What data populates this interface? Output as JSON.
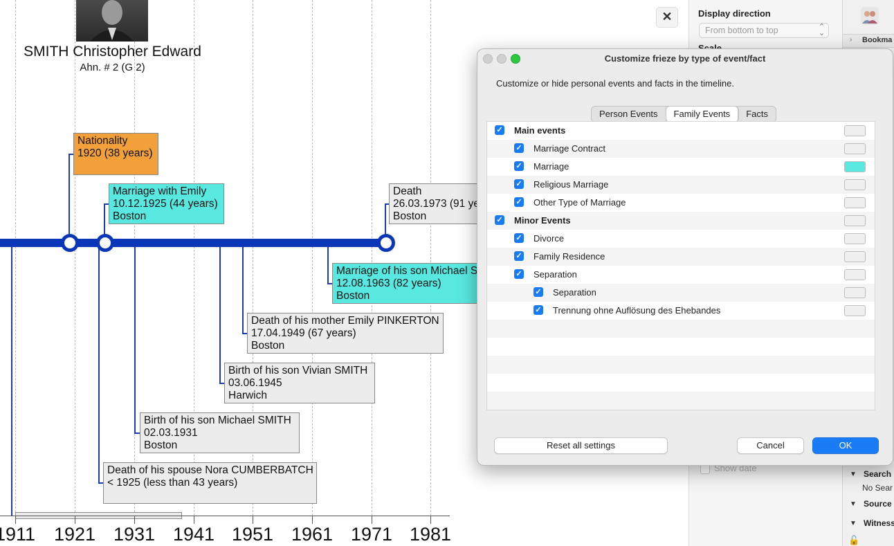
{
  "person": {
    "name": "SMITH Christopher Edward",
    "sub": "Ahn. # 2 (G 2)"
  },
  "timeline": {
    "years": [
      "1911",
      "1921",
      "1931",
      "1941",
      "1951",
      "1961",
      "1971",
      "1981"
    ],
    "events": [
      {
        "l1": "Nationality",
        "l2": "1920 (38 years)",
        "l3": ""
      },
      {
        "l1": "Marriage with Emily",
        "l2": "10.12.1925 (44 years)",
        "l3": "Boston"
      },
      {
        "l1": "Death",
        "l2": "26.03.1973 (91 ye",
        "l3": "Boston"
      },
      {
        "l1": "Marriage of his son Michael S",
        "l2": "12.08.1963 (82 years)",
        "l3": "Boston"
      },
      {
        "l1": "Death of his mother Emily PINKERTON",
        "l2": "17.04.1949 (67 years)",
        "l3": "Boston"
      },
      {
        "l1": "Birth of his son Vivian SMITH",
        "l2": "03.06.1945",
        "l3": "Harwich"
      },
      {
        "l1": "Birth of his son Michael SMITH",
        "l2": "02.03.1931",
        "l3": "Boston"
      },
      {
        "l1": "Death of his spouse Nora CUMBERBATCH",
        "l2": "< 1925 (less than 43 years)",
        "l3": ""
      }
    ],
    "close_label": "✕"
  },
  "sidebar": {
    "display_direction_label": "Display direction",
    "display_direction_value": "From bottom to top",
    "scale_label": "Scale",
    "show_date_label": "Show date",
    "bookmarks_label": "Bookma",
    "search_label": "Search",
    "no_search_label": "No Sear",
    "sources_label": "Source",
    "witness_label": "Witness"
  },
  "dialog": {
    "title": "Customize frieze by type of event/fact",
    "description": "Customize or hide personal events and facts in the timeline.",
    "tabs": [
      "Person Events",
      "Family Events",
      "Facts"
    ],
    "selected_tab": "Family Events",
    "rows": [
      {
        "label": "Main events",
        "level": 0,
        "bold": true,
        "checked": true,
        "color": "#efefef"
      },
      {
        "label": "Marriage Contract",
        "level": 1,
        "bold": false,
        "checked": true,
        "color": "#efefef"
      },
      {
        "label": "Marriage",
        "level": 1,
        "bold": false,
        "checked": true,
        "color": "#58e8e0"
      },
      {
        "label": "Religious Marriage",
        "level": 1,
        "bold": false,
        "checked": true,
        "color": "#efefef"
      },
      {
        "label": "Other Type of Marriage",
        "level": 1,
        "bold": false,
        "checked": true,
        "color": "#efefef"
      },
      {
        "label": "Minor Events",
        "level": 0,
        "bold": true,
        "checked": true,
        "color": "#efefef"
      },
      {
        "label": "Divorce",
        "level": 1,
        "bold": false,
        "checked": true,
        "color": "#efefef"
      },
      {
        "label": "Family Residence",
        "level": 1,
        "bold": false,
        "checked": true,
        "color": "#efefef"
      },
      {
        "label": "Separation",
        "level": 1,
        "bold": false,
        "checked": true,
        "color": "#efefef"
      },
      {
        "label": "Separation",
        "level": 2,
        "bold": false,
        "checked": true,
        "color": "#efefef"
      },
      {
        "label": "Trennung ohne Auflösung des Ehebandes",
        "level": 2,
        "bold": false,
        "checked": true,
        "color": "#efefef"
      }
    ],
    "reset_label": "Reset all settings",
    "cancel_label": "Cancel",
    "ok_label": "OK"
  },
  "colors": {
    "timeline_bar": "#0a36b8",
    "marriage": "#58e8e0",
    "nationality": "#f2a03a",
    "accent": "#1a7cf5"
  }
}
